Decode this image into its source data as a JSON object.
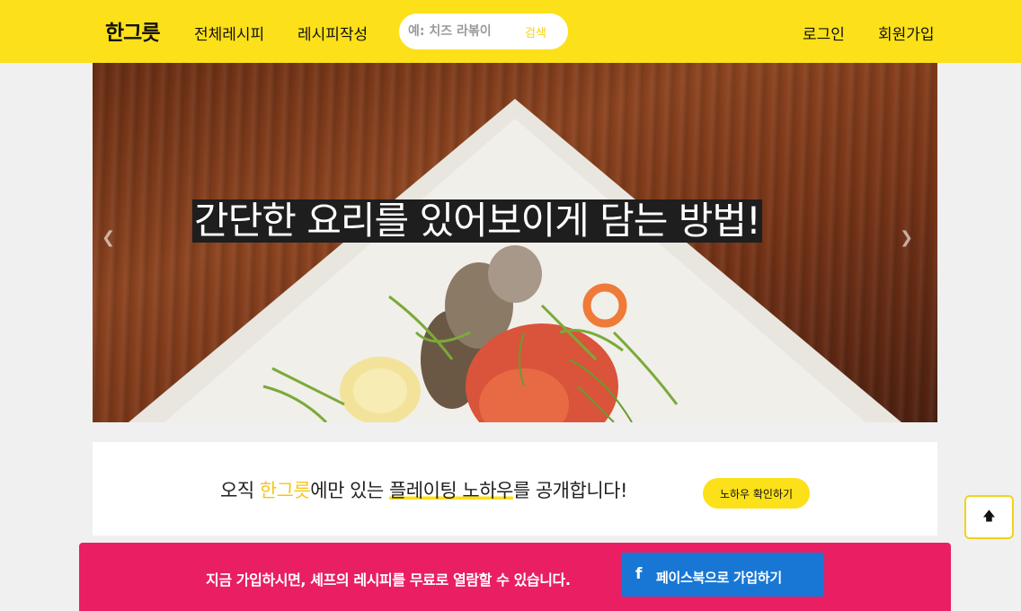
{
  "header": {
    "brand": "한그릇",
    "nav_all_recipes": "전체레시피",
    "nav_write_recipe": "레시피작성",
    "search_placeholder": "예: 치즈 라볶이",
    "search_button": "검색",
    "login": "로그인",
    "signup": "회원가입",
    "background_color": "#fce019"
  },
  "carousel": {
    "caption": "간단한 요리를 있어보이게 담는 방법!",
    "prev_icon": "chevron-left-icon",
    "next_icon": "chevron-right-icon"
  },
  "promo": {
    "prefix": "오직 ",
    "brand": "한그릇",
    "middle": "에만 있는 ",
    "highlight": "플레이팅 노하우",
    "suffix": "를 공개합니다!",
    "button": "노하우 확인하기",
    "brand_color": "#f5c518"
  },
  "scroll_top": {
    "icon": "arrow-up-icon"
  },
  "signup_bar": {
    "message": "지금 가입하시면, 셰프의 레시피를 무료로 열람할 수 있습니다.",
    "facebook_icon": "facebook-icon",
    "facebook_button": "페이스북으로 가입하기",
    "background_color": "#e91e63",
    "button_color": "#1877d4"
  }
}
